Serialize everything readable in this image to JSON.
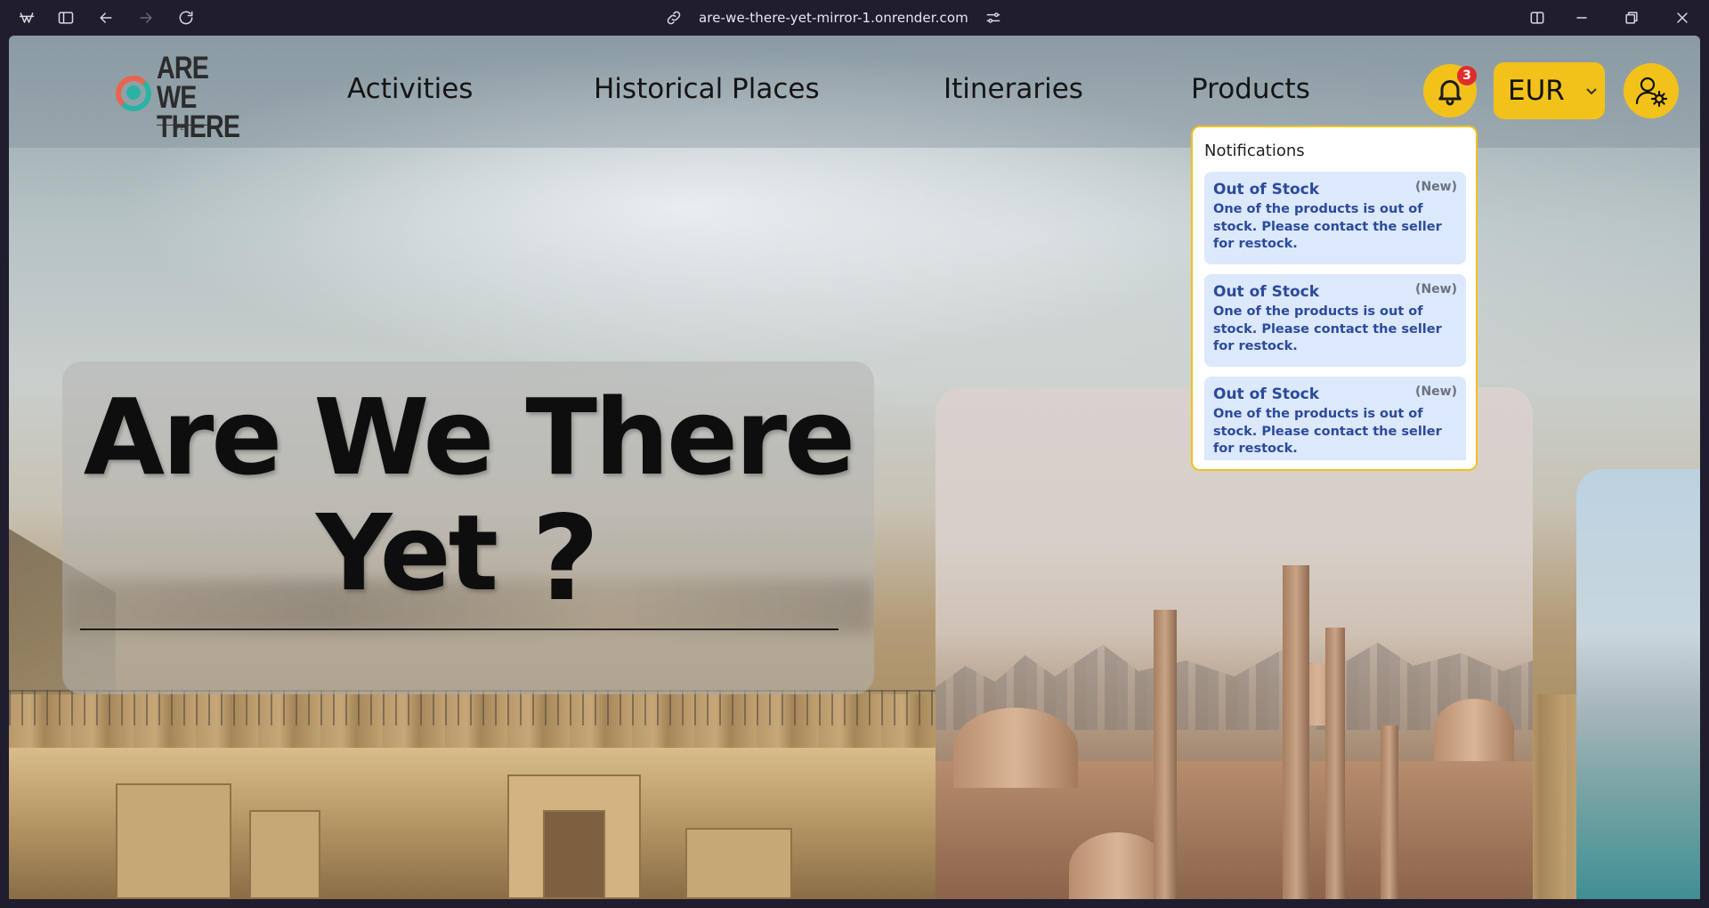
{
  "browser": {
    "url": "are-we-there-yet-mirror-1.onrender.com"
  },
  "site": {
    "logo": {
      "line1": "ARE WE",
      "line2": "THERE",
      "line3": "YET"
    },
    "nav": [
      {
        "label": "Activities"
      },
      {
        "label": "Historical Places"
      },
      {
        "label": "Itineraries"
      },
      {
        "label": "Products"
      }
    ],
    "notification_count": "3",
    "currency": "EUR"
  },
  "hero": {
    "title_line1": "Are We There",
    "title_line2": "Yet",
    "question_mark": "?"
  },
  "notifications": {
    "heading": "Notifications",
    "items": [
      {
        "title": "Out of Stock",
        "tag": "(New)",
        "body": "One of the products is out of stock. Please contact the seller for restock."
      },
      {
        "title": "Out of Stock",
        "tag": "(New)",
        "body": "One of the products is out of stock. Please contact the seller for restock."
      },
      {
        "title": "Out of Stock",
        "tag": "(New)",
        "body": "One of the products is out of stock. Please contact the seller for restock."
      }
    ]
  },
  "colors": {
    "accent": "#f2c21a",
    "badge": "#e22b2b",
    "notification_bg": "#dce8fb",
    "notification_text": "#2b4a9c"
  },
  "icons": [
    "app-logo-icon",
    "sidebar-toggle-icon",
    "back-icon",
    "forward-icon",
    "reload-icon",
    "link-icon",
    "site-settings-icon",
    "split-view-icon",
    "minimize-icon",
    "restore-icon",
    "close-icon",
    "bell-icon",
    "chevron-down-icon",
    "user-settings-icon"
  ]
}
